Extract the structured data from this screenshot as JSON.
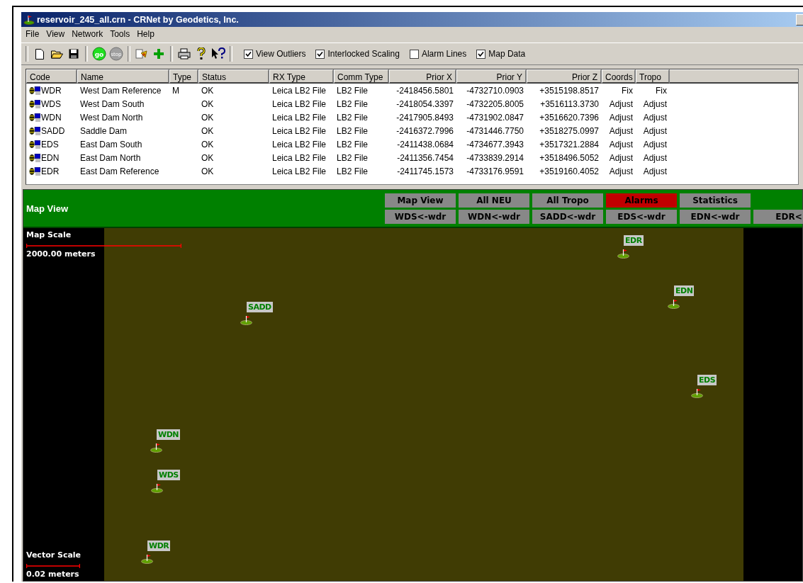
{
  "window": {
    "title": "reservoir_245_all.crn - CRNet by Geodetics, Inc."
  },
  "menu": [
    {
      "label": "File"
    },
    {
      "label": "View"
    },
    {
      "label": "Network"
    },
    {
      "label": "Tools"
    },
    {
      "label": "Help"
    }
  ],
  "toolbar": {
    "go_label": "go",
    "stop_label": "stop",
    "options": [
      {
        "label": "View Outliers",
        "checked": true
      },
      {
        "label": "Interlocked Scaling",
        "checked": true
      },
      {
        "label": "Alarm Lines",
        "checked": false
      },
      {
        "label": "Map Data",
        "checked": true
      }
    ]
  },
  "table": {
    "columns": [
      "Code",
      "Name",
      "Type",
      "Status",
      "RX Type",
      "Comm Type",
      "Prior X",
      "Prior Y",
      "Prior Z",
      "Coords",
      "Tropo"
    ],
    "rows": [
      [
        "WDR",
        "West Dam Reference",
        "M",
        "OK",
        "Leica LB2 File",
        "LB2 File",
        "-2418456.5801",
        "-4732710.0903",
        "+3515198.8517",
        "Fix",
        "Fix"
      ],
      [
        "WDS",
        "West Dam South",
        "",
        "OK",
        "Leica LB2 File",
        "LB2 File",
        "-2418054.3397",
        "-4732205.8005",
        "+3516113.3730",
        "Adjust",
        "Adjust"
      ],
      [
        "WDN",
        "West Dam North",
        "",
        "OK",
        "Leica LB2 File",
        "LB2 File",
        "-2417905.8493",
        "-4731902.0847",
        "+3516620.7396",
        "Adjust",
        "Adjust"
      ],
      [
        "SADD",
        "Saddle Dam",
        "",
        "OK",
        "Leica LB2 File",
        "LB2 File",
        "-2416372.7996",
        "-4731446.7750",
        "+3518275.0997",
        "Adjust",
        "Adjust"
      ],
      [
        "EDS",
        "East Dam South",
        "",
        "OK",
        "Leica LB2 File",
        "LB2 File",
        "-2411438.0684",
        "-4734677.3943",
        "+3517321.2884",
        "Adjust",
        "Adjust"
      ],
      [
        "EDN",
        "East Dam North",
        "",
        "OK",
        "Leica LB2 File",
        "LB2 File",
        "-2411356.7454",
        "-4733839.2914",
        "+3518496.5052",
        "Adjust",
        "Adjust"
      ],
      [
        "EDR",
        "East Dam Reference",
        "",
        "OK",
        "Leica LB2 File",
        "LB2 File",
        "-2411745.1573",
        "-4733176.9591",
        "+3519160.4052",
        "Adjust",
        "Adjust"
      ]
    ]
  },
  "panel": {
    "title": "Map View",
    "view_buttons": [
      {
        "label": "Map View",
        "alarm": false
      },
      {
        "label": "All NEU",
        "alarm": false
      },
      {
        "label": "All Tropo",
        "alarm": false
      },
      {
        "label": "Alarms",
        "alarm": true
      },
      {
        "label": "Statistics",
        "alarm": false
      }
    ],
    "pair_buttons": [
      {
        "label": "WDS<-wdr"
      },
      {
        "label": "WDN<-wdr"
      },
      {
        "label": "SADD<-wdr"
      },
      {
        "label": "EDS<-wdr"
      },
      {
        "label": "EDN<-wdr"
      },
      {
        "label": "EDR<"
      }
    ]
  },
  "map": {
    "scale_title": "Map Scale",
    "scale_text": "2000.00 meters",
    "vector_title": "Vector Scale",
    "vector_text": "0.02 meters",
    "stations": [
      {
        "label": "EDR"
      },
      {
        "label": "EDN"
      },
      {
        "label": "SADD"
      },
      {
        "label": "EDS"
      },
      {
        "label": "WDN"
      },
      {
        "label": "WDS"
      },
      {
        "label": "WDR"
      }
    ]
  }
}
